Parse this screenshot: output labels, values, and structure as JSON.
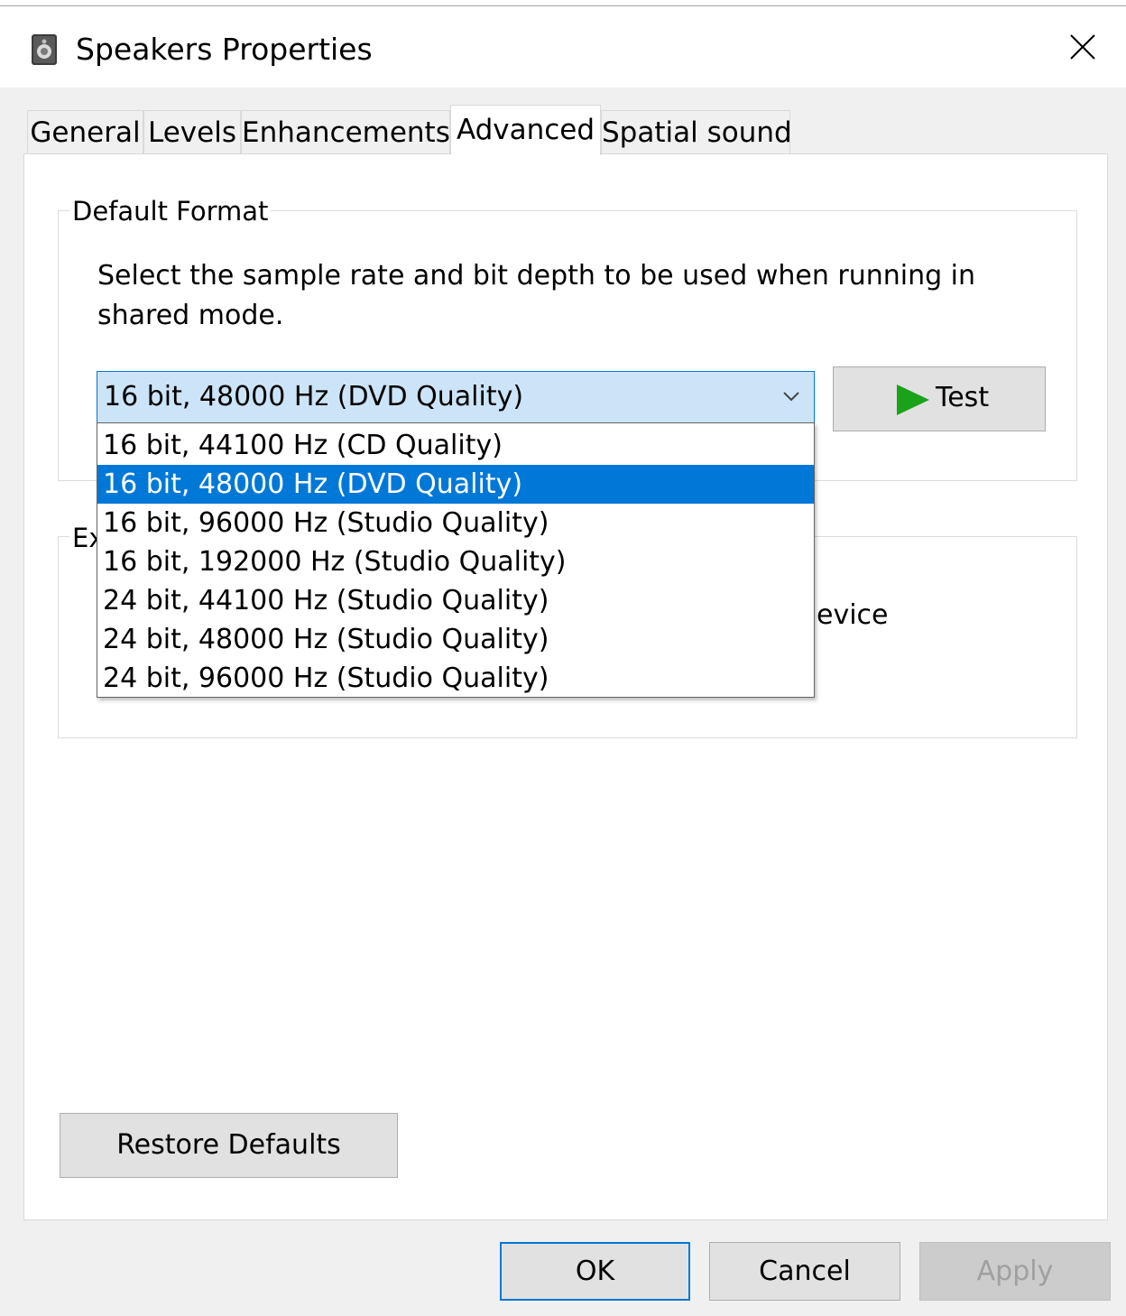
{
  "window": {
    "title": "Speakers Properties",
    "icon": "speaker-icon",
    "close_icon": "close-icon"
  },
  "tabs": [
    {
      "label": "General"
    },
    {
      "label": "Levels"
    },
    {
      "label": "Enhancements"
    },
    {
      "label": "Advanced"
    },
    {
      "label": "Spatial sound"
    }
  ],
  "active_tab": "Advanced",
  "default_format": {
    "group_label": "Default Format",
    "description": "Select the sample rate and bit depth to be used when running in shared mode.",
    "selected_value": "16 bit, 48000 Hz (DVD Quality)",
    "test_label": "Test",
    "options": [
      {
        "label": "16 bit, 44100 Hz (CD Quality)"
      },
      {
        "label": "16 bit, 48000 Hz (DVD Quality)"
      },
      {
        "label": "16 bit, 96000 Hz (Studio Quality)"
      },
      {
        "label": "16 bit, 192000 Hz (Studio Quality)"
      },
      {
        "label": "24 bit, 44100 Hz (Studio Quality)"
      },
      {
        "label": "24 bit, 48000 Hz (Studio Quality)"
      },
      {
        "label": "24 bit, 96000 Hz (Studio Quality)"
      }
    ]
  },
  "exclusive_mode": {
    "group_label_partial": "Ex",
    "visible_fragment": "evice"
  },
  "restore_defaults_label": "Restore Defaults",
  "footer": {
    "ok_label": "OK",
    "cancel_label": "Cancel",
    "apply_label": "Apply"
  },
  "colors": {
    "accent": "#0078d7",
    "selection_bg": "#cce4f7",
    "test_play": "#1aa319"
  }
}
